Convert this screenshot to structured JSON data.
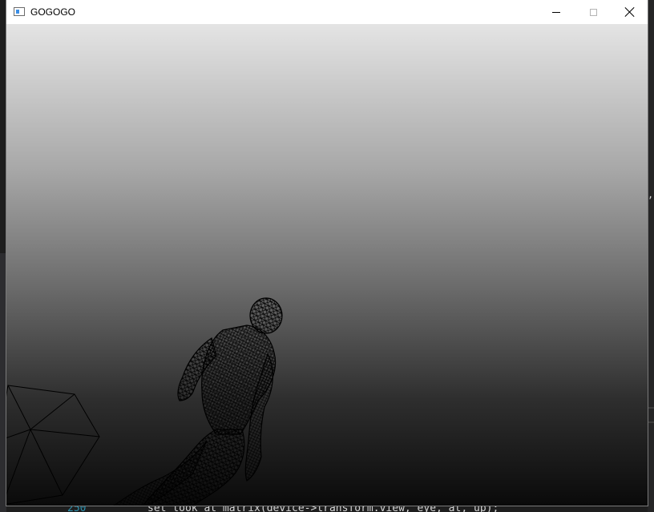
{
  "window": {
    "title": "GOGOGO",
    "minimize_label": "",
    "maximize_label": "",
    "close_label": ""
  },
  "viewport": {
    "background_top": "#e4e4e4",
    "background_bottom": "#0a0a0a",
    "mesh_color": "#000000",
    "objects": [
      "wireframe-human-model",
      "wireframe-polyhedron"
    ]
  },
  "background_editor": {
    "line_number": "250",
    "code": "set_look_at_matrix(device->transform.view, eye, at, up);"
  }
}
